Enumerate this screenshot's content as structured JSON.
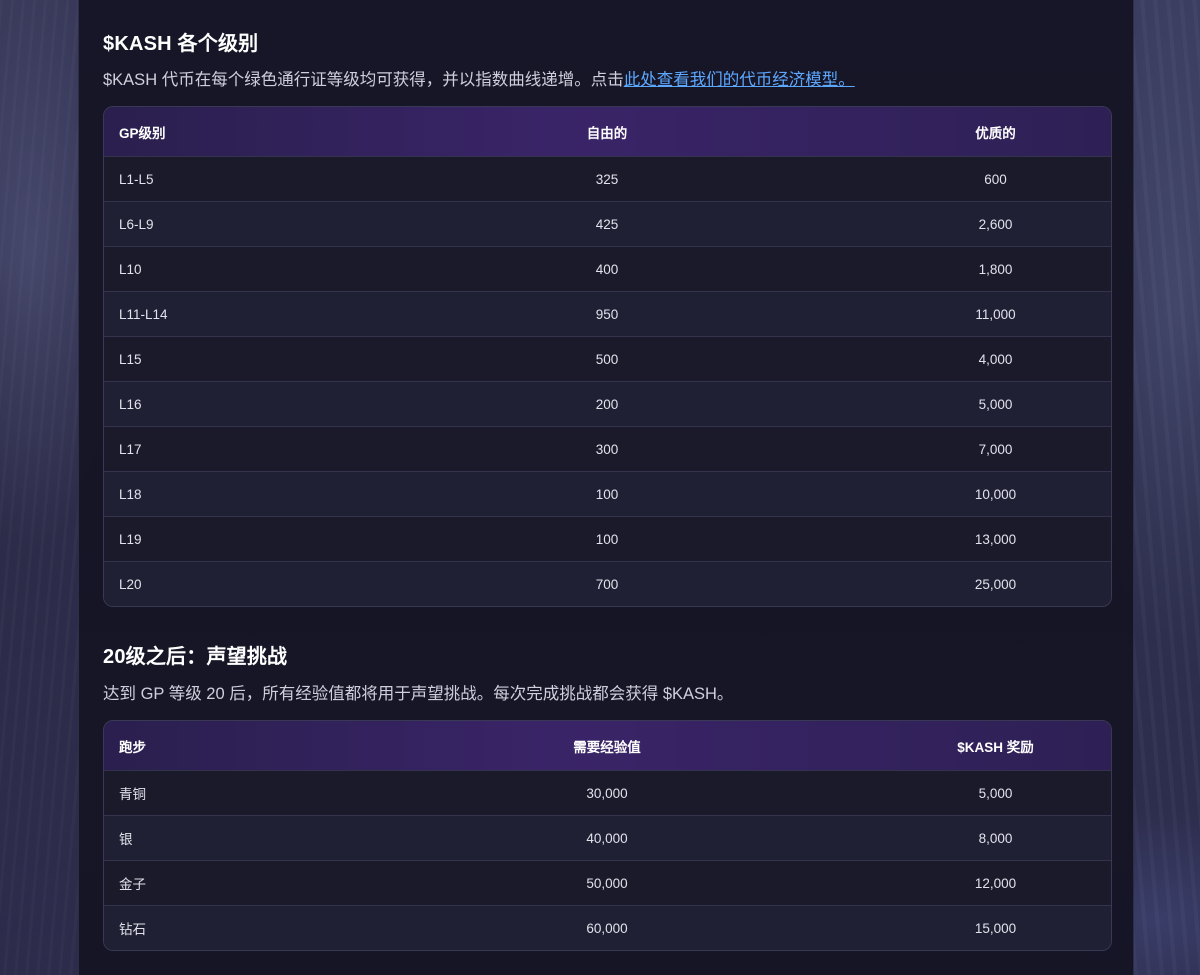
{
  "section1": {
    "title": "$KASH 各个级别",
    "paragraph_text": "$KASH 代币在每个绿色通行证等级均可获得，并以指数曲线递增。点击",
    "link_text": "此处查看我们的代币经济模型。",
    "table": {
      "headers": [
        "GP级别",
        "自由的",
        "优质的"
      ],
      "rows": [
        [
          "L1-L5",
          "325",
          "600"
        ],
        [
          "L6-L9",
          "425",
          "2,600"
        ],
        [
          "L10",
          "400",
          "1,800"
        ],
        [
          "L11-L14",
          "950",
          "11,000"
        ],
        [
          "L15",
          "500",
          "4,000"
        ],
        [
          "L16",
          "200",
          "5,000"
        ],
        [
          "L17",
          "300",
          "7,000"
        ],
        [
          "L18",
          "100",
          "10,000"
        ],
        [
          "L19",
          "100",
          "13,000"
        ],
        [
          "L20",
          "700",
          "25,000"
        ]
      ]
    }
  },
  "section2": {
    "title": "20级之后：声望挑战",
    "paragraph_text": "达到 GP 等级 20 后，所有经验值都将用于声望挑战。每次完成挑战都会获得 $KASH。",
    "table": {
      "headers": [
        "跑步",
        "需要经验值",
        "$KASH 奖励"
      ],
      "rows": [
        [
          "青铜",
          "30,000",
          "5,000"
        ],
        [
          "银",
          "40,000",
          "8,000"
        ],
        [
          "金子",
          "50,000",
          "12,000"
        ],
        [
          "钻石",
          "60,000",
          "15,000"
        ]
      ]
    }
  },
  "colors": {
    "link": "#5da8ff",
    "header_gradient_mid": "#3a2468",
    "panel_bg": "#16152a"
  }
}
